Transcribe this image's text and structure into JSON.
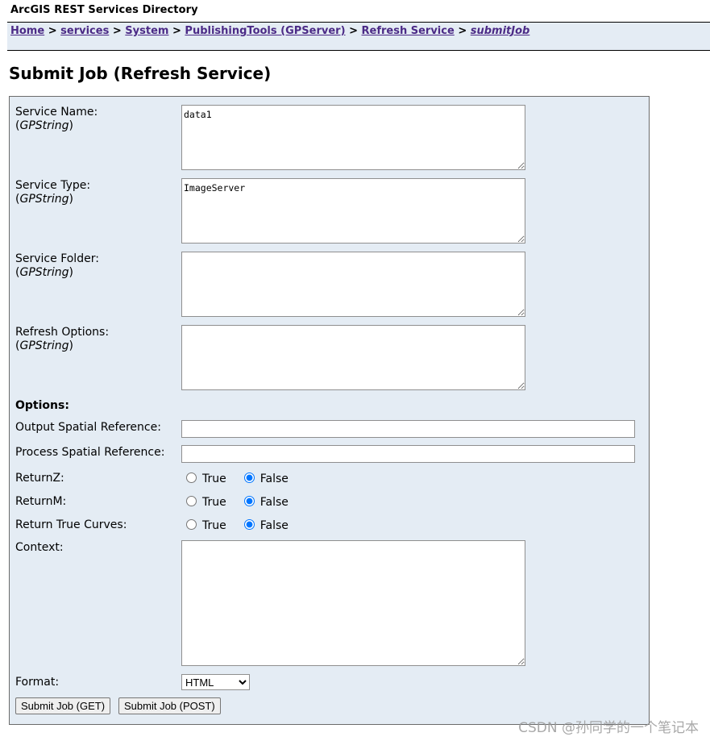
{
  "header": {
    "directory_title": "ArcGIS REST Services Directory"
  },
  "breadcrumb": {
    "items": [
      "Home",
      "services",
      "System",
      "PublishingTools (GPServer)",
      "Refresh Service"
    ],
    "current": "submitJob",
    "separator": ">"
  },
  "page": {
    "title": "Submit Job (Refresh Service)"
  },
  "form": {
    "service_name": {
      "label": "Service Name:",
      "type_prefix": "(",
      "type": "GPString",
      "type_suffix": ")",
      "value": "data1"
    },
    "service_type": {
      "label": "Service Type:",
      "type_prefix": "(",
      "type": "GPString",
      "type_suffix": ")",
      "value": "ImageServer"
    },
    "service_folder": {
      "label": "Service Folder:",
      "type_prefix": "(",
      "type": "GPString",
      "type_suffix": ")",
      "value": ""
    },
    "refresh_options": {
      "label": "Refresh Options:",
      "type_prefix": "(",
      "type": "GPString",
      "type_suffix": ")",
      "value": ""
    },
    "options_heading": "Options:",
    "output_sr": {
      "label": "Output Spatial Reference:",
      "value": ""
    },
    "process_sr": {
      "label": "Process Spatial Reference:",
      "value": ""
    },
    "return_z": {
      "label": "ReturnZ:",
      "true_label": "True",
      "false_label": "False",
      "selected": "False"
    },
    "return_m": {
      "label": "ReturnM:",
      "true_label": "True",
      "false_label": "False",
      "selected": "False"
    },
    "return_true_curves": {
      "label": "Return True Curves:",
      "true_label": "True",
      "false_label": "False",
      "selected": "False"
    },
    "context": {
      "label": "Context:",
      "value": ""
    },
    "format": {
      "label": "Format:",
      "selected": "HTML"
    },
    "submit_get_label": "Submit Job (GET)",
    "submit_post_label": "Submit Job (POST)"
  },
  "watermark": "CSDN @孙同学的一个笔记本"
}
